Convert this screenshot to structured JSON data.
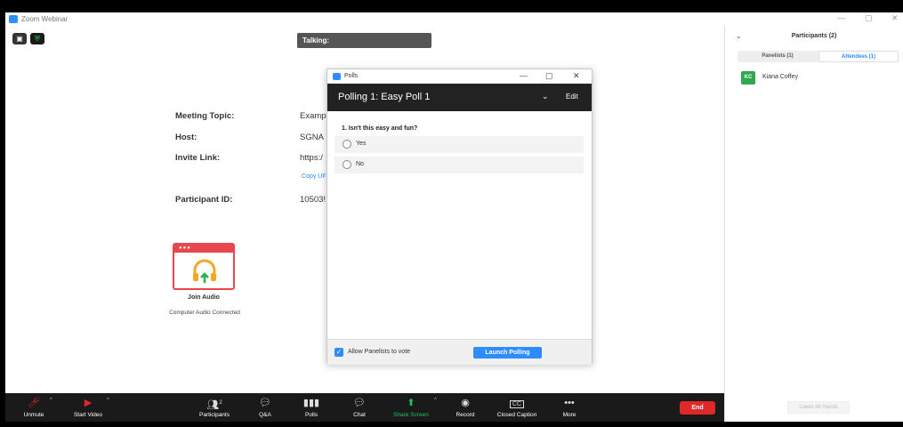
{
  "window": {
    "title": "Zoom Webinar",
    "controls": [
      "—",
      "▢",
      "✕"
    ]
  },
  "main": {
    "talking_label": "Talking:",
    "meeting_info": [
      {
        "label": "Meeting Topic:",
        "value": "Examp"
      },
      {
        "label": "Host:",
        "value": "SGNA"
      },
      {
        "label": "Invite Link:",
        "value": "https:/"
      },
      {
        "label": "Participant ID:",
        "value": "10503!"
      }
    ],
    "copy_url": "Copy UF",
    "join_audio": {
      "label": "Join Audio",
      "status": "Computer Audio Connected",
      "icon": "headphones-icon",
      "accent": "#e8484d"
    }
  },
  "polls": {
    "window_title": "Polls",
    "controls": [
      "—",
      "▢",
      "✕"
    ],
    "poll_name": "Polling 1: Easy Poll 1",
    "edit_label": "Edit",
    "question": "1. Isn't this easy and fun?",
    "options": [
      "Yes",
      "No"
    ],
    "allow_panelists_label": "Allow Panelists to vote",
    "allow_panelists_checked": true,
    "launch_label": "Launch Polling"
  },
  "participants": {
    "title": "Participants (2)",
    "tabs": [
      {
        "label": "Panelists (1)",
        "active": false
      },
      {
        "label": "Attendees (1)",
        "active": true
      }
    ],
    "attendees": [
      {
        "initials": "KC",
        "name": "Kiana Coffey",
        "color": "#2fa84f"
      }
    ],
    "lower_all_hands": "Lower All Hands"
  },
  "toolbar": {
    "unmute": "Unmute",
    "start_video": "Start Video",
    "participants": "Participants",
    "participants_count": "2",
    "qa": "Q&A",
    "polls": "Polls",
    "chat": "Chat",
    "share_screen": "Share Screen",
    "record": "Record",
    "closed_caption": "Closed Caption",
    "more": "More",
    "end": "End"
  },
  "colors": {
    "accent": "#2d8cff",
    "share_green": "#22c55e",
    "end_red": "#e02828"
  }
}
